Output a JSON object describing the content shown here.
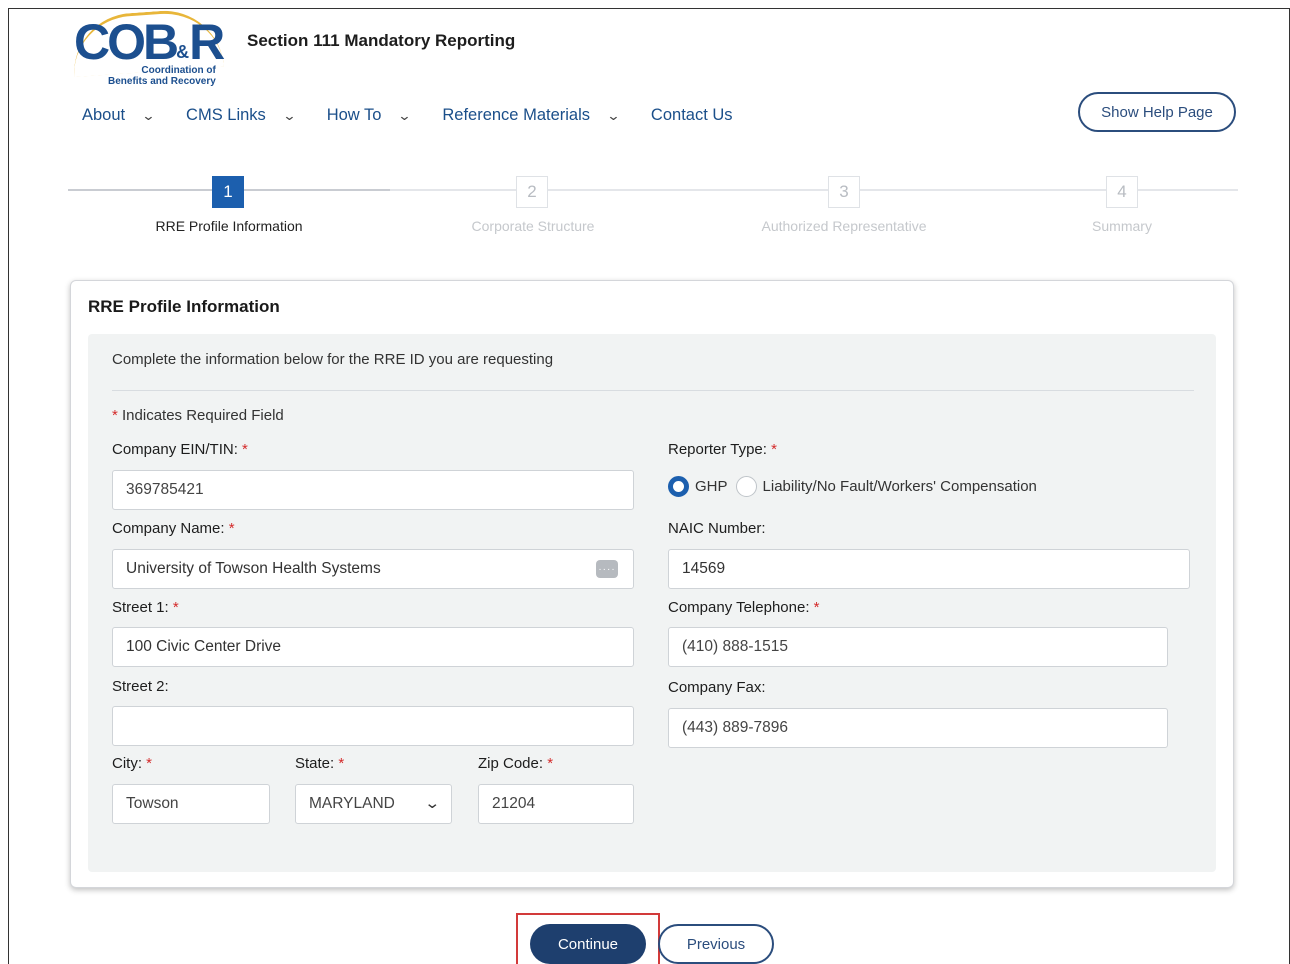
{
  "header": {
    "logo_text": "COB",
    "logo_amp": "&",
    "logo_r": "R",
    "logo_sub_line1": "Coordination of",
    "logo_sub_line2": "Benefits and Recovery",
    "title": "Section 111 Mandatory Reporting",
    "help_button": "Show Help Page"
  },
  "nav": {
    "items": [
      {
        "label": "About",
        "has_dropdown": true
      },
      {
        "label": "CMS Links",
        "has_dropdown": true
      },
      {
        "label": "How To",
        "has_dropdown": true
      },
      {
        "label": "Reference Materials",
        "has_dropdown": true
      },
      {
        "label": "Contact Us",
        "has_dropdown": false
      }
    ],
    "chevron_glyph": "⌄"
  },
  "stepper": {
    "steps": [
      {
        "number": "1",
        "label": "RRE Profile Information",
        "active": true
      },
      {
        "number": "2",
        "label": "Corporate Structure",
        "active": false
      },
      {
        "number": "3",
        "label": "Authorized Representative",
        "active": false
      },
      {
        "number": "4",
        "label": "Summary",
        "active": false
      }
    ]
  },
  "form": {
    "card_title": "RRE Profile Information",
    "intro": "Complete the information below for the RRE ID you are requesting",
    "required_star": "*",
    "required_note": "Indicates Required Field",
    "fields": {
      "ein": {
        "label": "Company EIN/TIN:",
        "value": "369785421"
      },
      "company_name": {
        "label": "Company Name:",
        "value": "University of Towson Health Systems"
      },
      "street1": {
        "label": "Street 1:",
        "value": "100 Civic Center Drive"
      },
      "street2": {
        "label": "Street 2:",
        "value": ""
      },
      "city": {
        "label": "City:",
        "value": "Towson"
      },
      "state": {
        "label": "State:",
        "value": "MARYLAND"
      },
      "zip": {
        "label": "Zip Code:",
        "value": "21204"
      },
      "reporter_type": {
        "label": "Reporter Type:",
        "options": [
          "GHP",
          "Liability/No Fault/Workers' Compensation"
        ],
        "selected": "GHP"
      },
      "naic": {
        "label": "NAIC Number:",
        "value": "14569"
      },
      "telephone": {
        "label": "Company Telephone:",
        "value": "(410) 888-1515"
      },
      "fax": {
        "label": "Company Fax:",
        "value": "(443) 889-7896"
      }
    },
    "more_icon_glyph": "····"
  },
  "actions": {
    "continue_label": "Continue",
    "previous_label": "Previous"
  },
  "colors": {
    "brand_blue": "#1c5fae",
    "navy_button": "#1e3f6e",
    "required_red": "#d42a2a",
    "highlight_red": "#d23a3a"
  }
}
